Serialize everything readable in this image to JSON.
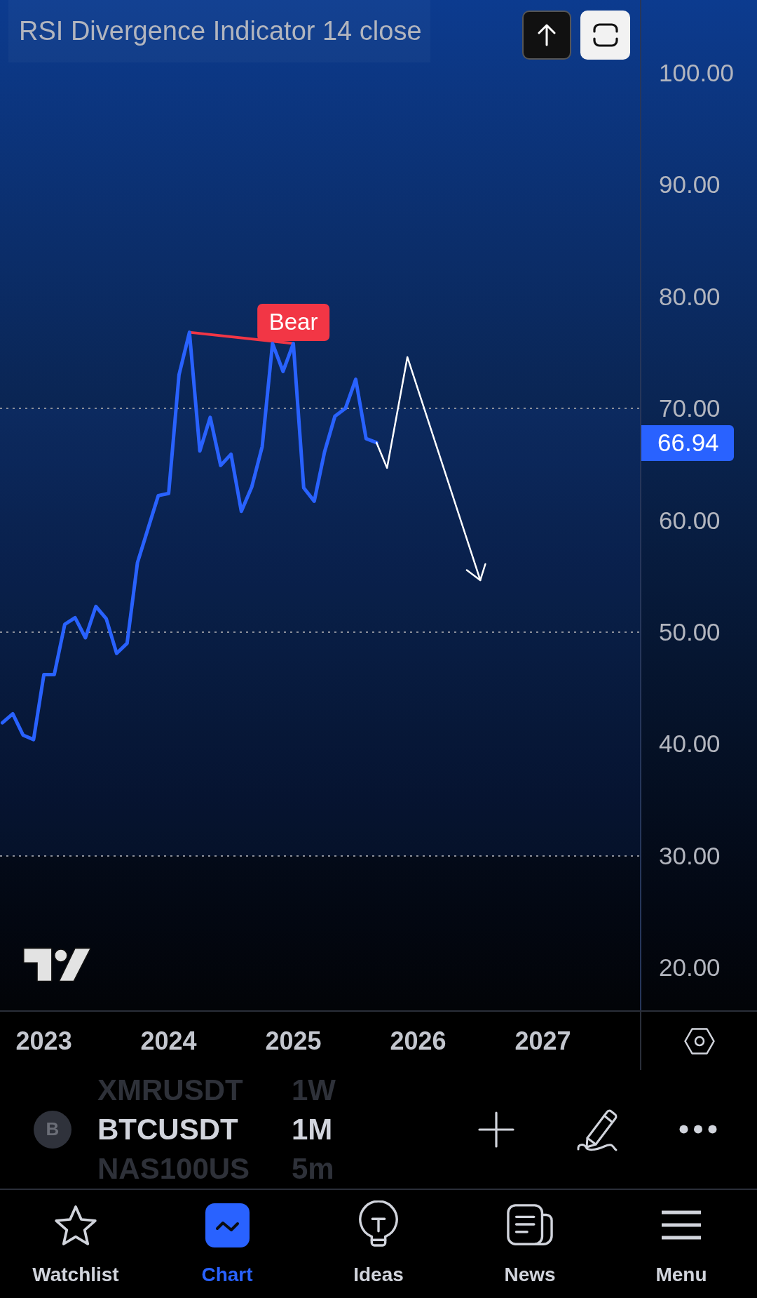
{
  "chart": {
    "chart_data": {
      "type": "line",
      "title": "RSI Divergence Indicator 14 close",
      "x": [
        2022.667,
        2022.75,
        2022.833,
        2022.917,
        2023,
        2023.083,
        2023.167,
        2023.25,
        2023.333,
        2023.417,
        2023.5,
        2023.583,
        2023.667,
        2023.75,
        2023.833,
        2023.917,
        2024,
        2024.083,
        2024.167,
        2024.25,
        2024.333,
        2024.417,
        2024.5,
        2024.583,
        2024.667,
        2024.75,
        2024.833,
        2024.917,
        2025,
        2025.083,
        2025.167,
        2025.25,
        2025.333,
        2025.417,
        2025.5,
        2025.583,
        2025.667
      ],
      "series": [
        {
          "color": "#2962ff",
          "values": [
            41.9,
            42.7,
            40.8,
            40.4,
            46.2,
            46.2,
            50.7,
            51.3,
            49.5,
            52.3,
            51.2,
            48.1,
            49.0,
            56.2,
            59.2,
            62.2,
            62.4,
            73.0,
            76.8,
            66.2,
            69.2,
            64.9,
            65.9,
            60.8,
            63.0,
            66.6,
            75.8,
            73.3,
            75.8,
            62.9,
            61.7,
            66.1,
            69.3,
            70.0,
            72.6,
            67.3,
            66.94
          ]
        }
      ],
      "xlim": [
        2022.648,
        2028.717
      ],
      "ylim": [
        16.2,
        106.5
      ],
      "xticks": [
        2023,
        2024,
        2025,
        2026,
        2027
      ],
      "yticks": [
        {
          "value": 100,
          "label": "100.00"
        },
        {
          "value": 90,
          "label": "90.00"
        },
        {
          "value": 80,
          "label": "80.00"
        },
        {
          "value": 70,
          "label": "70.00"
        },
        {
          "value": 60,
          "label": "60.00"
        },
        {
          "value": 50,
          "label": "50.00"
        },
        {
          "value": 40,
          "label": "40.00"
        },
        {
          "value": 30,
          "label": "30.00"
        },
        {
          "value": 20,
          "label": "20.00"
        }
      ],
      "ref_lines": [
        {
          "axis": "y",
          "value": 70
        },
        {
          "axis": "y",
          "value": 50
        },
        {
          "axis": "y",
          "value": 30
        }
      ],
      "bands": [
        {
          "axis": "y",
          "from": 30,
          "to": 70
        }
      ],
      "annotations": [
        {
          "text": "Bear",
          "x": 2025,
          "y": 75.8
        }
      ]
    },
    "last_value_label": "66.94"
  },
  "symbol_bar": {
    "items": [
      {
        "symbol": "XMRUSDT",
        "interval": "1W",
        "selected": false
      },
      {
        "logo": "B",
        "symbol": "BTCUSDT",
        "interval": "1M",
        "selected": true
      },
      {
        "symbol": "NAS100US",
        "interval": "5m",
        "selected": false
      }
    ]
  },
  "bottom_nav": {
    "items": [
      {
        "label": "Watchlist",
        "selected": false
      },
      {
        "label": "Chart",
        "selected": true
      },
      {
        "label": "Ideas",
        "selected": false
      },
      {
        "label": "News",
        "selected": false
      },
      {
        "label": "Menu",
        "selected": false
      }
    ]
  }
}
